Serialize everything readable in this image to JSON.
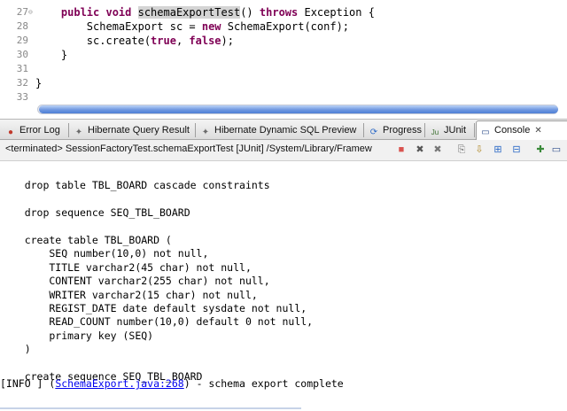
{
  "editor": {
    "lines": [
      {
        "num": "27",
        "fold": "⊖",
        "parts": [
          {
            "t": "    "
          },
          {
            "t": "public void ",
            "kw": true
          },
          {
            "t": "schemaExportTest",
            "hl": true
          },
          {
            "t": "() "
          },
          {
            "t": "throws ",
            "kw": true
          },
          {
            "t": "Exception {"
          }
        ]
      },
      {
        "num": "28",
        "fold": "",
        "parts": [
          {
            "t": "        SchemaExport sc = "
          },
          {
            "t": "new ",
            "kw": true
          },
          {
            "t": "SchemaExport(conf);"
          }
        ]
      },
      {
        "num": "29",
        "fold": "",
        "parts": [
          {
            "t": "        sc.create("
          },
          {
            "t": "true",
            "kw": true
          },
          {
            "t": ", "
          },
          {
            "t": "false",
            "kw": true
          },
          {
            "t": ");"
          }
        ]
      },
      {
        "num": "30",
        "fold": "",
        "parts": [
          {
            "t": "    }"
          }
        ]
      },
      {
        "num": "31",
        "fold": "",
        "parts": [
          {
            "t": ""
          }
        ]
      },
      {
        "num": "32",
        "fold": "",
        "parts": [
          {
            "t": "}"
          }
        ]
      },
      {
        "num": "33",
        "fold": "",
        "parts": [
          {
            "t": ""
          }
        ]
      }
    ]
  },
  "tabs": [
    {
      "label": "Error Log",
      "icon": "error-log-icon",
      "glyph": "●",
      "color": "#c0392b",
      "active": false
    },
    {
      "label": "Hibernate Query Result",
      "icon": "hibernate-icon",
      "glyph": "✦",
      "color": "#6b6b6b",
      "active": false
    },
    {
      "label": "Hibernate Dynamic SQL Preview",
      "icon": "hibernate-icon",
      "glyph": "✦",
      "color": "#6b6b6b",
      "active": false
    },
    {
      "label": "Progress",
      "icon": "progress-icon",
      "glyph": "⟳",
      "color": "#2e6bc7",
      "active": false
    },
    {
      "label": "JUnit",
      "icon": "junit-icon",
      "glyph": "Ju",
      "color": "#3a6e2e",
      "active": false
    },
    {
      "label": "Console",
      "icon": "console-icon",
      "glyph": "▭",
      "color": "#2e4d8a",
      "active": true,
      "close": "✕"
    }
  ],
  "status": {
    "text": "<terminated> SessionFactoryTest.schemaExportTest [JUnit] /System/Library/Framew"
  },
  "toolbar": [
    {
      "name": "terminate-icon",
      "glyph": "■",
      "color": "#d9534f"
    },
    {
      "name": "remove-launch-icon",
      "glyph": "✖",
      "color": "#555555"
    },
    {
      "name": "remove-all-terminated-icon",
      "glyph": "✖",
      "color": "#777777"
    },
    {
      "name": "clear-console-icon",
      "glyph": "⎘",
      "color": "#6a6a6a"
    },
    {
      "name": "scroll-lock-icon",
      "glyph": "⇩",
      "color": "#b08a2a"
    },
    {
      "name": "pin-console-icon",
      "glyph": "⊞",
      "color": "#2e6bc7"
    },
    {
      "name": "display-selected-console-icon",
      "glyph": "⊟",
      "color": "#2e6bc7"
    },
    {
      "name": "open-console-icon",
      "glyph": "✚",
      "color": "#3a8a3a"
    },
    {
      "name": "view-menu-icon",
      "glyph": "▭",
      "color": "#2e4d8a"
    }
  ],
  "console": {
    "lines": [
      "",
      "    drop table TBL_BOARD cascade constraints",
      "",
      "    drop sequence SEQ_TBL_BOARD",
      "",
      "    create table TBL_BOARD (",
      "        SEQ number(10,0) not null,",
      "        TITLE varchar2(45 char) not null,",
      "        CONTENT varchar2(255 char) not null,",
      "        WRITER varchar2(15 char) not null,",
      "        REGIST_DATE date default sysdate not null,",
      "        READ_COUNT number(10,0) default 0 not null,",
      "        primary key (SEQ)",
      "    )",
      "",
      "    create sequence SEQ_TBL_BOARD"
    ],
    "info_prefix": "[INFO ] (",
    "info_link": "SchemaExport.java:268",
    "info_suffix": ") - schema export complete"
  }
}
